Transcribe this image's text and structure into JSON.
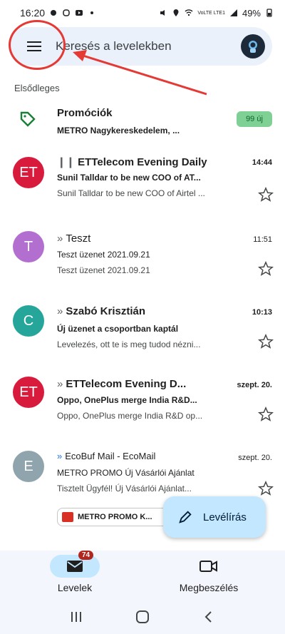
{
  "status": {
    "time": "16:20",
    "battery": "49%",
    "signal_text": "VoLTE LTE1"
  },
  "search": {
    "placeholder": "Keresés a levelekben"
  },
  "section": {
    "label": "Elsődleges"
  },
  "promo": {
    "sender": "Promóciók",
    "preview": "METRO Nagykereskedelem, ...",
    "badge": "99 új"
  },
  "emails": [
    {
      "initials": "ET",
      "color": "#d81b3c",
      "sender": "ETTelecom Evening Daily",
      "time": "14:44",
      "subject": "Sunil Talldar to be new COO of AT...",
      "preview": "Sunil Talldar to be new COO of Airtel ..."
    },
    {
      "initials": "T",
      "color": "#b36fd0",
      "sender": "Teszt",
      "time": "11:51",
      "subject": "Teszt üzenet 2021.09.21",
      "preview": "Teszt üzenet 2021.09.21"
    },
    {
      "initials": "C",
      "color": "#26a69a",
      "sender": "Szabó Krisztián",
      "time": "10:13",
      "subject": "Új üzenet a csoportban kaptál",
      "preview": "Levelezés, ott te is meg tudod nézni..."
    },
    {
      "initials": "ET",
      "color": "#d81b3c",
      "sender": "ETTelecom Evening D...",
      "time": "szept. 20.",
      "subject": "Oppo, OnePlus merge India R&D...",
      "preview": "Oppo, OnePlus merge India R&D op..."
    },
    {
      "initials": "E",
      "color": "#90a4ae",
      "sender": "EcoBuf Mail - EcoMail",
      "time": "szept. 20.",
      "subject": "METRO PROMO Új Vásárlói Ajánlat",
      "preview": "Tisztelt Ügyfél! Új Vásárlói Ajánlat...",
      "attachment": "METRO PROMO K..."
    }
  ],
  "fab": {
    "label": "Levélírás"
  },
  "nav": {
    "mail_label": "Levelek",
    "mail_badge": "74",
    "meet_label": "Megbeszélés"
  }
}
